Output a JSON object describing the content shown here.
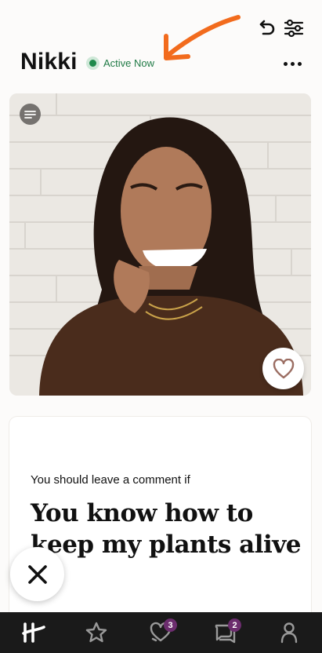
{
  "profile": {
    "name": "Nikki",
    "status": "Active Now"
  },
  "prompt": {
    "question": "You should leave a comment if",
    "answer": "You know how to keep my plants alive"
  },
  "tabbar": {
    "items": [
      {
        "name": "home",
        "icon": "hinge-logo-icon",
        "badge": null
      },
      {
        "name": "standouts",
        "icon": "star-icon",
        "badge": null
      },
      {
        "name": "likes",
        "icon": "heart-chat-icon",
        "badge": "3"
      },
      {
        "name": "matches",
        "icon": "chat-bubbles-icon",
        "badge": "2"
      },
      {
        "name": "profile",
        "icon": "person-icon",
        "badge": null
      }
    ]
  },
  "colors": {
    "active_green": "#1f8a4c",
    "annotation_arrow": "#f26b1d",
    "badge_purple": "#6c2d6e",
    "tabbar_bg": "#1a1a1a"
  }
}
